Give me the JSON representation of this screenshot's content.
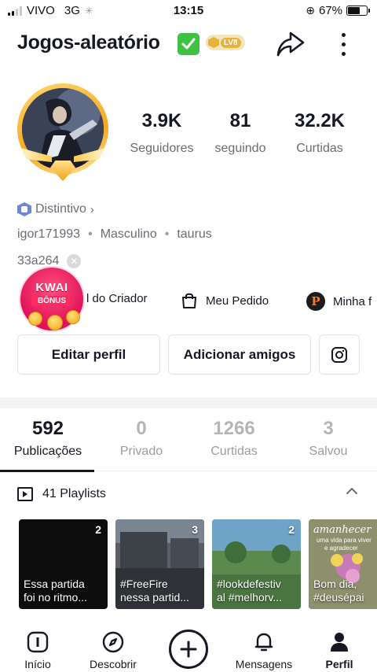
{
  "status_bar": {
    "carrier": "VIVO",
    "network": "3G",
    "time": "13:15",
    "battery_percent": "67%",
    "battery_level": 0.67
  },
  "header": {
    "username": "Jogos-aleatório",
    "level_badge": "LV8",
    "share_icon": "share-arrow-icon",
    "more_icon": "vertical-dots-icon"
  },
  "stats": [
    {
      "value": "3.9K",
      "label": "Seguidores"
    },
    {
      "value": "81",
      "label": "seguindo"
    },
    {
      "value": "32.2K",
      "label": "Curtidas"
    }
  ],
  "profile": {
    "badge_label": "Distintivo",
    "handle": "igor171993",
    "gender": "Masculino",
    "sign": "taurus",
    "separator": "•",
    "bio_id": "33a264"
  },
  "kwai_bonus": {
    "line1": "KWAI",
    "line2": "BÔNUS"
  },
  "shortcuts": {
    "creator": "l do Criador",
    "orders": "Meu Pedido",
    "more": "Minha f",
    "p_letter": "P"
  },
  "actions": {
    "edit": "Editar perfil",
    "add_friends": "Adicionar amigos",
    "instagram_icon": "instagram-icon"
  },
  "tabs": [
    {
      "value": "592",
      "label": "Publicações",
      "active": true
    },
    {
      "value": "0",
      "label": "Privado",
      "active": false
    },
    {
      "value": "1266",
      "label": "Curtidas",
      "active": false
    },
    {
      "value": "3",
      "label": "Salvou",
      "active": false
    }
  ],
  "playlists": {
    "title": "41 Playlists",
    "items": [
      {
        "count": "2",
        "line1": "Essa partida",
        "line2": "foi no ritmo...",
        "color": "#0c0c0c"
      },
      {
        "count": "3",
        "line1": "#FreeFire",
        "line2": "nessa partid...",
        "color": "#4a4f57"
      },
      {
        "count": "2",
        "line1": "#lookdefestiv",
        "line2": "al #melhorv...",
        "color": "#4f7a6e"
      },
      {
        "count": "",
        "line1": "Bom dia,",
        "line2": "#deusépai",
        "color": "#7a7d5e",
        "overlay1": "amanhecer",
        "overlay2": "uma vida para viver",
        "overlay3": "e agradecer"
      }
    ]
  },
  "bottom_nav": [
    {
      "label": "Início",
      "icon": "home-icon",
      "active": false
    },
    {
      "label": "Descobrir",
      "icon": "compass-icon",
      "active": false
    },
    {
      "label": "",
      "icon": "plus-icon",
      "active": false
    },
    {
      "label": "Mensagens",
      "icon": "bell-icon",
      "active": false
    },
    {
      "label": "Perfil",
      "icon": "profile-icon",
      "active": true
    }
  ],
  "colors": {
    "text_primary": "#161823",
    "text_secondary": "#6b6d75",
    "verified_green": "#3ec241",
    "gold": "#e8b13a",
    "kwai_pink": "#e0115a"
  }
}
